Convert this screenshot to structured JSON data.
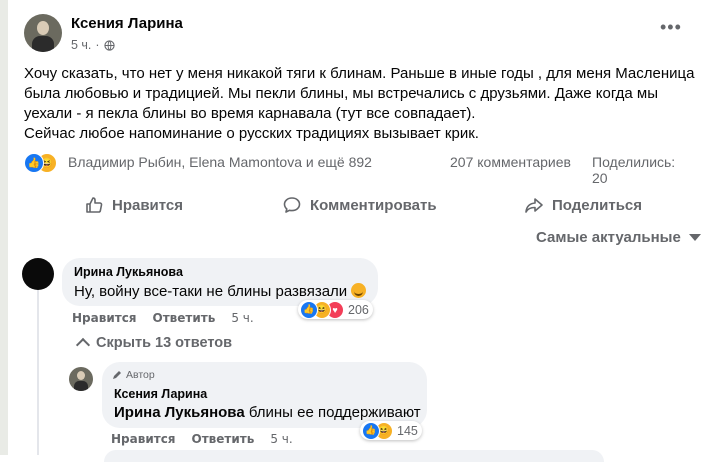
{
  "post": {
    "author": "Ксения Ларина",
    "time": "5 ч.",
    "privacy_icon": "globe-icon",
    "more_label": "•••",
    "text_lines": [
      "Хочу сказать, что нет у меня никакой тяги к блинам. Раньше в иные годы , для меня Масленица",
      "была любовью и традицией.  Мы пекли блины, мы встречались с друзьями. Даже когда мы",
      "уехали - я пекла блины во время карнавала (тут все совпадает).",
      "Сейчас любое напоминание о русских традициях вызывает крик."
    ]
  },
  "reactions": {
    "icons": [
      "like-icon",
      "haha-icon"
    ],
    "reactors": "Владимир Рыбин, Elena Mamontova и ещё 892",
    "comments": "207 комментариев",
    "shares": "Поделились: 20"
  },
  "actions": {
    "like": "Нравится",
    "comment": "Комментировать",
    "share": "Поделиться"
  },
  "sort_label": "Самые актуальные",
  "comments": [
    {
      "author": "Ирина Лукьянова",
      "text": "Ну, войну все-таки не блины развязали",
      "reaction_count": "206",
      "like": "Нравится",
      "reply": "Ответить",
      "time": "5 ч."
    }
  ],
  "hide_replies": "Скрыть 13 ответов",
  "reply": {
    "badge": "Автор",
    "author": "Ксения Ларина",
    "mention": "Ирина Лукьянова",
    "text": " блины ее поддерживают",
    "reaction_count": "145",
    "like": "Нравится",
    "reply": "Ответить",
    "time": "5 ч."
  },
  "colors": {
    "like_blue": "#1877f2",
    "haha_yellow": "#f7b125",
    "care_red": "#f33e58",
    "secondary_text": "#65676b",
    "bubble_bg": "#f0f2f5"
  }
}
